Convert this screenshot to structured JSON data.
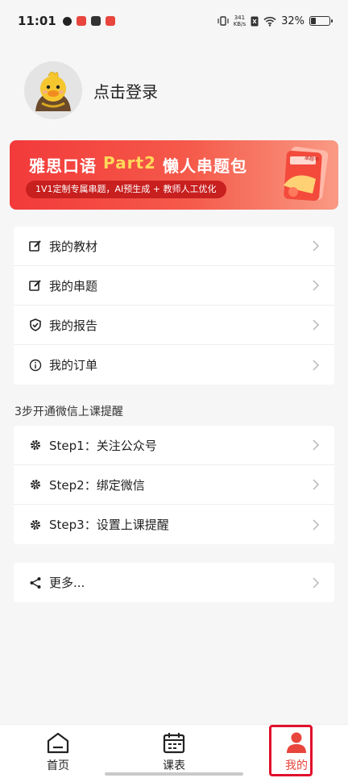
{
  "status_bar": {
    "time": "11:01",
    "net_speed_value": "341",
    "net_speed_unit": "KB/s",
    "battery": "32%"
  },
  "profile": {
    "login_text": "点击登录"
  },
  "banner": {
    "title_part1": "雅思口语",
    "title_highlight": "Part2",
    "title_part2": "懒人串题包",
    "subtitle": "1V1定制专属串题，AI预生成 + 教师人工优化",
    "art_label": "串题书",
    "colors": {
      "start": "#f23a3a",
      "end": "#f99a84",
      "highlight": "#ffd95a"
    }
  },
  "menu_main": [
    {
      "label": "我的教材",
      "icon": "edit-icon"
    },
    {
      "label": "我的串题",
      "icon": "edit-icon"
    },
    {
      "label": "我的报告",
      "icon": "shield-icon"
    },
    {
      "label": "我的订单",
      "icon": "info-icon"
    }
  ],
  "wechat_section": {
    "title": "3步开通微信上课提醒",
    "items": [
      {
        "label": "Step1：关注公众号",
        "icon": "gear-icon"
      },
      {
        "label": "Step2：绑定微信",
        "icon": "gear-icon"
      },
      {
        "label": "Step3：设置上课提醒",
        "icon": "gear-icon"
      }
    ]
  },
  "more": {
    "label": "更多...",
    "icon": "share-icon"
  },
  "tabbar": {
    "tabs": [
      {
        "label": "首页",
        "icon": "home-icon"
      },
      {
        "label": "课表",
        "icon": "calendar-icon"
      },
      {
        "label": "我的",
        "icon": "user-icon",
        "active": true
      }
    ],
    "active_color": "#e8453c"
  }
}
